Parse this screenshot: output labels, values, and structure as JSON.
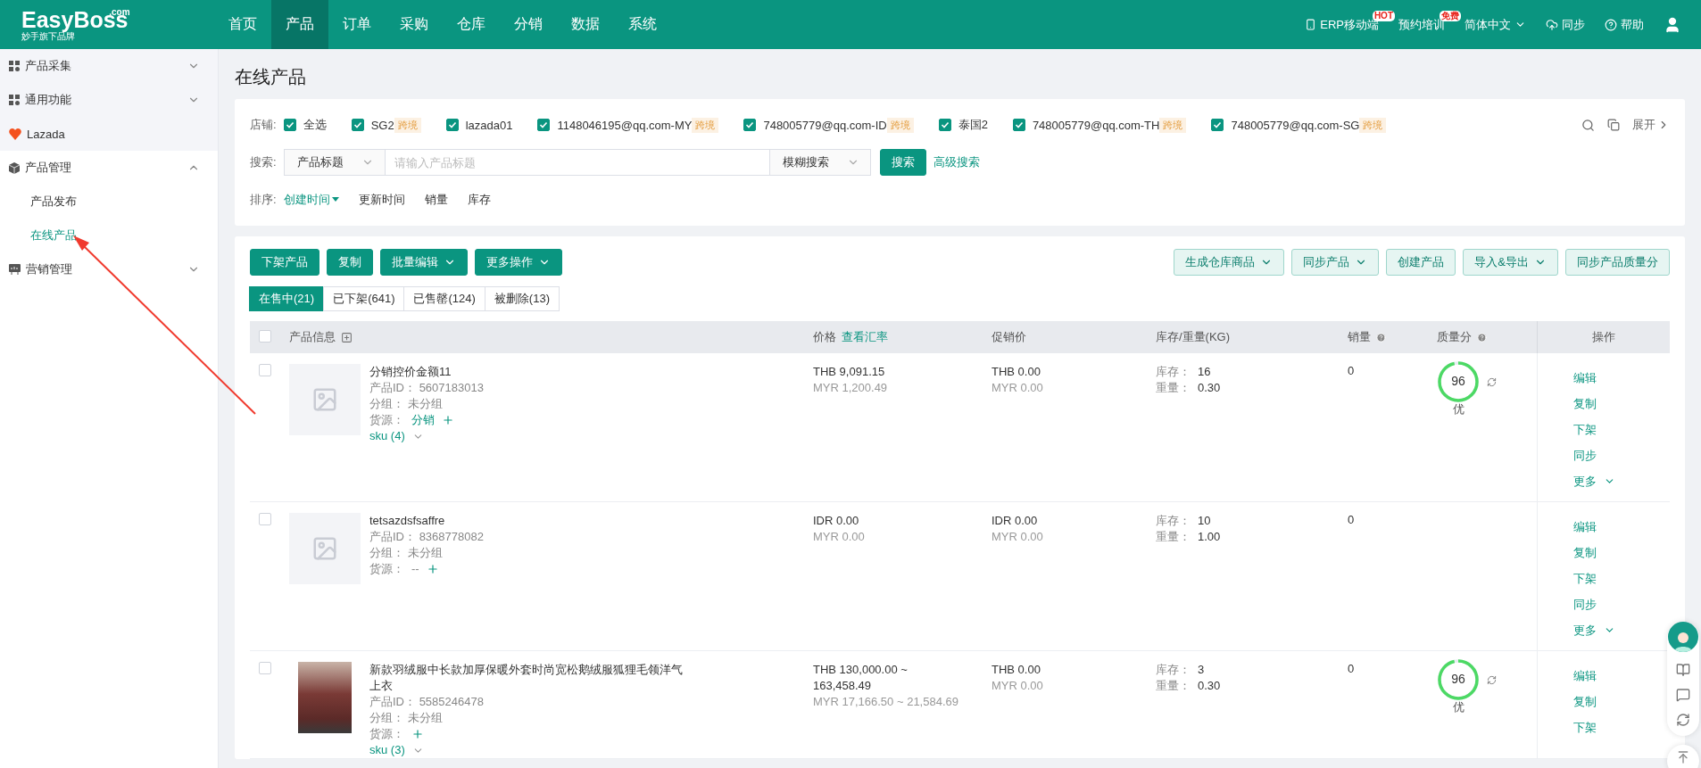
{
  "brand": {
    "name": "EasyBoss",
    "domain": ".com",
    "tagline": "妙手旗下品牌"
  },
  "nav": [
    {
      "label": "首页",
      "selected": false
    },
    {
      "label": "产品",
      "selected": true
    },
    {
      "label": "订单",
      "selected": false
    },
    {
      "label": "采购",
      "selected": false
    },
    {
      "label": "仓库",
      "selected": false
    },
    {
      "label": "分销",
      "selected": false
    },
    {
      "label": "数据",
      "selected": false
    },
    {
      "label": "系统",
      "selected": false
    }
  ],
  "header_actions": [
    {
      "kind": "mobile",
      "label": "ERP移动端",
      "badge": "HOT"
    },
    {
      "kind": "training",
      "label": "预约培训",
      "badge": "免费"
    },
    {
      "kind": "language",
      "label": "简体中文"
    },
    {
      "kind": "sync",
      "label": "同步"
    },
    {
      "kind": "help",
      "label": "帮助"
    },
    {
      "kind": "user"
    }
  ],
  "sidebar": {
    "items": [
      {
        "kind": "grid",
        "label": "产品采集",
        "expanded": false
      },
      {
        "kind": "grid",
        "label": "通用功能",
        "expanded": false
      },
      {
        "kind": "platform",
        "label": "Lazada"
      },
      {
        "kind": "box",
        "label": "产品管理",
        "expanded": true,
        "children": [
          {
            "label": "产品发布",
            "selected": false
          },
          {
            "label": "在线产品",
            "selected": true
          }
        ]
      },
      {
        "kind": "board",
        "label": "营销管理",
        "expanded": false
      }
    ]
  },
  "page_title": "在线产品",
  "filters": {
    "store_label": "店铺:",
    "stores": [
      {
        "label": "全选",
        "checked": true
      },
      {
        "label": "SG2",
        "tag": "跨境",
        "checked": true
      },
      {
        "label": "lazada01",
        "checked": true
      },
      {
        "label": "1148046195@qq.com-MY",
        "tag": "跨境",
        "checked": true
      },
      {
        "label": "748005779@qq.com-ID",
        "tag": "跨境",
        "checked": true
      },
      {
        "label": "泰国2",
        "checked": true
      },
      {
        "label": "748005779@qq.com-TH",
        "tag": "跨境",
        "checked": true
      },
      {
        "label": "748005779@qq.com-SG",
        "tag": "跨境",
        "checked": true
      }
    ],
    "expand": "展开",
    "search_label": "搜索:",
    "search_field": "产品标题",
    "search_placeholder": "请输入产品标题",
    "search_mode": "模糊搜索",
    "search_button": "搜索",
    "advanced": "高级搜索",
    "sort_label": "排序:",
    "sort_options": [
      {
        "label": "创建时间",
        "selected": true
      },
      {
        "label": "更新时间",
        "selected": false
      },
      {
        "label": "销量",
        "selected": false
      },
      {
        "label": "库存",
        "selected": false
      }
    ]
  },
  "toolbar": {
    "left": [
      {
        "label": "下架产品",
        "dropdown": false
      },
      {
        "label": "复制",
        "dropdown": false
      },
      {
        "label": "批量编辑",
        "dropdown": true
      },
      {
        "label": "更多操作",
        "dropdown": true
      }
    ],
    "right": [
      {
        "label": "生成仓库商品",
        "dropdown": true
      },
      {
        "label": "同步产品",
        "dropdown": true
      },
      {
        "label": "创建产品",
        "dropdown": false
      },
      {
        "label": "导入&导出",
        "dropdown": true
      },
      {
        "label": "同步产品质量分",
        "dropdown": false
      }
    ]
  },
  "status_tabs": [
    {
      "label": "在售中(21)",
      "selected": true
    },
    {
      "label": "已下架(641)",
      "selected": false
    },
    {
      "label": "已售罄(124)",
      "selected": false
    },
    {
      "label": "被删除(13)",
      "selected": false
    }
  ],
  "table": {
    "all_checked": false,
    "columns": [
      {
        "label": "产品信息",
        "kind": "expand"
      },
      {
        "label": "价格",
        "kind": "link",
        "link": "查看汇率"
      },
      {
        "label": "促销价",
        "kind": "plain"
      },
      {
        "label": "库存/重量(KG)",
        "kind": "plain"
      },
      {
        "label": "销量",
        "kind": "help"
      },
      {
        "label": "质量分",
        "kind": "help"
      },
      {
        "label": "操作",
        "kind": "center"
      }
    ],
    "rows": [
      {
        "kind": "placeholder",
        "checked": false,
        "title": "分销控价金额11",
        "id_label": "产品ID：",
        "id": "5607183013",
        "group_label": "分组：",
        "group": "未分组",
        "source_label": "货源：",
        "source": "分销",
        "sku": "sku (4)",
        "price": [
          "THB 9,091.15",
          "MYR 1,200.49"
        ],
        "promo": [
          "THB 0.00",
          "MYR 0.00"
        ],
        "stock_label": "库存：",
        "stock": "16",
        "weight_label": "重量：",
        "weight": "0.30",
        "sales": "0",
        "quality": {
          "score": "96",
          "level": 0.96,
          "grade": "优"
        },
        "actions": [
          "编辑",
          "复制",
          "下架",
          "同步"
        ],
        "more": "更多"
      },
      {
        "kind": "placeholder",
        "checked": false,
        "title": "tetsazdsfsaffre",
        "id_label": "产品ID：",
        "id": "8368778082",
        "group_label": "分组：",
        "group": "未分组",
        "source_label": "货源：",
        "source": "--",
        "price": [
          "IDR 0.00",
          "MYR 0.00"
        ],
        "promo": [
          "IDR 0.00",
          "MYR 0.00"
        ],
        "stock_label": "库存：",
        "stock": "10",
        "weight_label": "重量：",
        "weight": "1.00",
        "sales": "0",
        "actions": [
          "编辑",
          "复制",
          "下架",
          "同步"
        ],
        "more": "更多"
      },
      {
        "kind": "photo",
        "checked": false,
        "title": "新款羽绒服中长款加厚保暖外套时尚宽松鹅绒服狐狸毛领洋气上衣",
        "id_label": "产品ID：",
        "id": "5585246478",
        "group_label": "分组：",
        "group": "未分组",
        "source_label": "货源：",
        "sku": "sku (3)",
        "price": [
          "THB 130,000.00 ~ 163,458.49",
          "MYR 17,166.50 ~ 21,584.69"
        ],
        "promo": [
          "THB 0.00",
          "MYR 0.00"
        ],
        "stock_label": "库存：",
        "stock": "3",
        "weight_label": "重量：",
        "weight": "0.30",
        "sales": "0",
        "quality": {
          "score": "96",
          "level": 0.96,
          "grade": "优"
        },
        "actions": [
          "编辑",
          "复制",
          "下架"
        ]
      }
    ]
  }
}
